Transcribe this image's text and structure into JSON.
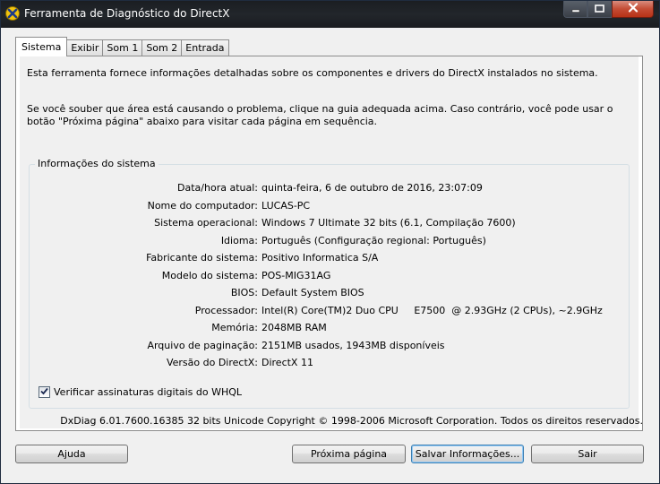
{
  "window": {
    "title": "Ferramenta de Diagnóstico do DirectX"
  },
  "tabs": [
    {
      "label": "Sistema",
      "active": true
    },
    {
      "label": "Exibir",
      "active": false
    },
    {
      "label": "Som 1",
      "active": false
    },
    {
      "label": "Som 2",
      "active": false
    },
    {
      "label": "Entrada",
      "active": false
    }
  ],
  "intro": {
    "line1": "Esta ferramenta fornece informações detalhadas sobre os componentes e drivers do DirectX instalados no sistema.",
    "line2": "Se você souber que área está causando o problema, clique na guia adequada acima. Caso contrário, você pode usar o botão \"Próxima página\" abaixo para visitar cada página em sequência."
  },
  "system_info": {
    "title": "Informações do sistema",
    "rows": [
      {
        "label": "Data/hora atual:",
        "value": "quinta-feira, 6 de outubro de 2016, 23:07:09"
      },
      {
        "label": "Nome do computador:",
        "value": "LUCAS-PC"
      },
      {
        "label": "Sistema operacional:",
        "value": "Windows 7 Ultimate 32 bits (6.1, Compilação 7600)"
      },
      {
        "label": "Idioma:",
        "value": "Português (Configuração regional: Português)"
      },
      {
        "label": "Fabricante do sistema:",
        "value": "Positivo Informatica S/A"
      },
      {
        "label": "Modelo do sistema:",
        "value": "POS-MIG31AG"
      },
      {
        "label": "BIOS:",
        "value": "Default System BIOS"
      },
      {
        "label": "Processador:",
        "value": "Intel(R) Core(TM)2 Duo CPU     E7500  @ 2.93GHz (2 CPUs), ~2.9GHz"
      },
      {
        "label": "Memória:",
        "value": "2048MB RAM"
      },
      {
        "label": "Arquivo de paginação:",
        "value": "2151MB usados, 1943MB disponíveis"
      },
      {
        "label": "Versão do DirectX:",
        "value": "DirectX 11"
      }
    ],
    "whql_checkbox": {
      "label": "Verificar assinaturas digitais do WHQL",
      "checked": true
    }
  },
  "footer": "DxDiag 6.01.7600.16385 32 bits Unicode  Copyright © 1998-2006 Microsoft Corporation.  Todos os direitos reservados.",
  "buttons": {
    "help": "Ajuda",
    "next": "Próxima página",
    "save": "Salvar Informações...",
    "exit": "Sair"
  },
  "colors": {
    "titlebar": "#1b1e22",
    "close_button": "#c44c35",
    "dialog_background": "#f0f0f0",
    "default_button_border": "#3c7fb1"
  },
  "icons": {
    "app": "directx-icon",
    "minimize": "minimize-icon",
    "maximize": "maximize-icon",
    "close": "close-icon",
    "checkmark": "checkmark-icon"
  }
}
